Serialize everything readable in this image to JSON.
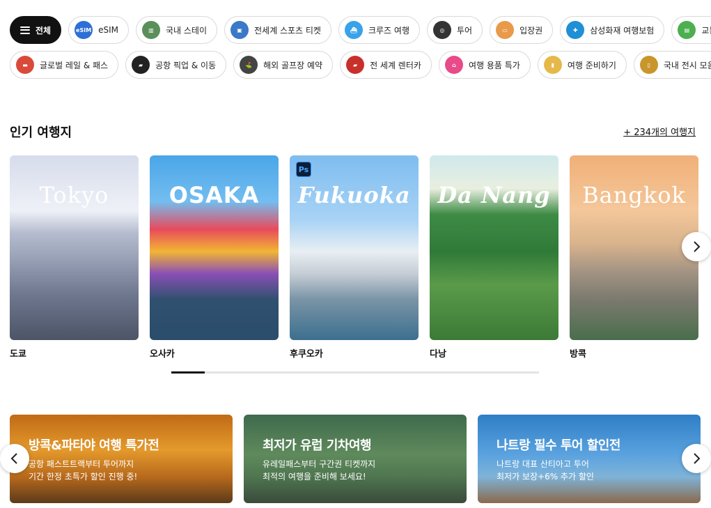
{
  "categories_row1": [
    {
      "label": "전체",
      "icon": "menu-icon",
      "active": true
    },
    {
      "label": "eSIM",
      "icon": "esim-icon",
      "color": "#2d6fd6"
    },
    {
      "label": "국내 스테이",
      "icon": "building-icon",
      "color": "#5a8f5a"
    },
    {
      "label": "전세계 스포츠 티켓",
      "icon": "ticket-icon",
      "color": "#3a78c8"
    },
    {
      "label": "크루즈 여행",
      "icon": "cruise-icon",
      "color": "#3aa2e8"
    },
    {
      "label": "투어",
      "icon": "binoculars-icon",
      "color": "#333333"
    },
    {
      "label": "입장권",
      "icon": "admission-ticket-icon",
      "color": "#e89a4a"
    },
    {
      "label": "삼성화재 여행보험",
      "icon": "insurance-icon",
      "color": "#1f8fd6"
    },
    {
      "label": "교통패스",
      "icon": "transit-pass-icon",
      "color": "#4caf50"
    }
  ],
  "categories_row2": [
    {
      "label": "글로벌 레일 & 패스",
      "icon": "train-icon",
      "color": "#d94a3a"
    },
    {
      "label": "공항 픽업 & 이동",
      "icon": "car-icon",
      "color": "#222222"
    },
    {
      "label": "해외 골프장 예약",
      "icon": "golf-icon",
      "color": "#444444"
    },
    {
      "label": "전 세계 렌터카",
      "icon": "rental-car-icon",
      "color": "#c8302b"
    },
    {
      "label": "여행 용품 특가",
      "icon": "travel-goods-icon",
      "color": "#e84a8a"
    },
    {
      "label": "여행 준비하기",
      "icon": "luggage-icon",
      "color": "#e6b84a"
    },
    {
      "label": "국내 전시 모음",
      "icon": "exhibition-icon",
      "color": "#c8962b"
    }
  ],
  "popular": {
    "title": "인기 여행지",
    "more_link": "+ 234개의 여행지",
    "destinations": [
      {
        "name": "도쿄",
        "overlay": "Tokyo"
      },
      {
        "name": "오사카",
        "overlay": "OSAKA"
      },
      {
        "name": "후쿠오카",
        "overlay": "Fukuoka",
        "badge": "Ps"
      },
      {
        "name": "다낭",
        "overlay": "Da Nang"
      },
      {
        "name": "방콕",
        "overlay": "Bangkok"
      }
    ],
    "scroll_progress": 0.09
  },
  "promos": [
    {
      "title": "방콕&파타야 여행 특가전",
      "line1": "공항 패스트트랙부터 투어까지",
      "line2": "기간 한정 초특가 할인 진행 중!"
    },
    {
      "title": "최저가 유럽 기차여행",
      "line1": "유레일패스부터 구간권 티켓까지",
      "line2": "최적의 여행을 준비해 보세요!"
    },
    {
      "title": "나트랑 필수 투어 할인전",
      "line1": "나트랑 대표 산티아고 투어",
      "line2": "최저가 보장+6% 추가 할인"
    }
  ]
}
